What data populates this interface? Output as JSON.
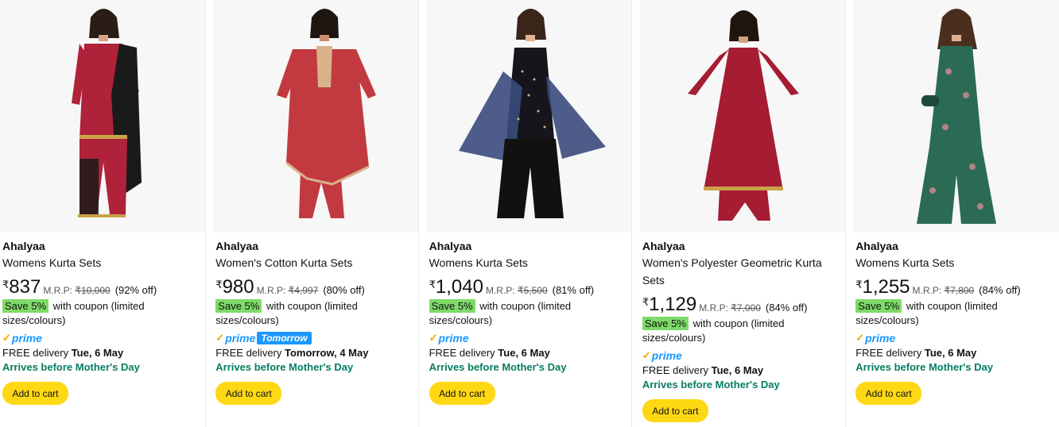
{
  "products": [
    {
      "brand": "Ahalyaa",
      "title": "Womens Kurta Sets",
      "currency": "₹",
      "price": "837",
      "mrp_label": "M.R.P:",
      "mrp": "₹10,000",
      "discount": "(92% off)",
      "coupon_badge": "Save 5%",
      "coupon_text": "with coupon (limited sizes/colours)",
      "prime": "prime",
      "prime_check": "✓",
      "delivery_prefix": "FREE delivery",
      "delivery_date": "Tue, 6 May",
      "arrives": "Arrives before Mother's Day",
      "cart": "Add to cart",
      "dress_color": "#b0213a",
      "dupatta_color": "#1a1a1a",
      "bottom_color": "#b0213a"
    },
    {
      "brand": "Ahalyaa",
      "title": "Women's Cotton Kurta Sets",
      "currency": "₹",
      "price": "980",
      "mrp_label": "M.R.P:",
      "mrp": "₹4,997",
      "discount": "(80% off)",
      "coupon_badge": "Save 5%",
      "coupon_text": "with coupon (limited sizes/colours)",
      "prime": "prime",
      "prime_check": "✓",
      "prime_tag": "Tomorrow",
      "delivery_prefix": "FREE delivery",
      "delivery_date": "Tomorrow, 4 May",
      "arrives": "Arrives before Mother's Day",
      "cart": "Add to cart",
      "dress_color": "#c23a3f",
      "bottom_color": "#c23a3f"
    },
    {
      "brand": "Ahalyaa",
      "title": "Womens Kurta Sets",
      "currency": "₹",
      "price": "1,040",
      "mrp_label": "M.R.P:",
      "mrp": "₹5,500",
      "discount": "(81% off)",
      "coupon_badge": "Save 5%",
      "coupon_text": "with coupon (limited sizes/colours)",
      "prime": "prime",
      "prime_check": "✓",
      "delivery_prefix": "FREE delivery",
      "delivery_date": "Tue, 6 May",
      "arrives": "Arrives before Mother's Day",
      "cart": "Add to cart",
      "dress_color": "#15151b",
      "dupatta_color": "#3b4a7c",
      "bottom_color": "#111111"
    },
    {
      "brand": "Ahalyaa",
      "title": "Women's Polyester Geometric Kurta Sets",
      "currency": "₹",
      "price": "1,129",
      "mrp_label": "M.R.P:",
      "mrp": "₹7,000",
      "discount": "(84% off)",
      "coupon_badge": "Save 5%",
      "coupon_text": "with coupon (limited sizes/colours)",
      "prime": "prime",
      "prime_check": "✓",
      "delivery_prefix": "FREE delivery",
      "delivery_date": "Tue, 6 May",
      "arrives": "Arrives before Mother's Day",
      "cart": "Add to cart",
      "dress_color": "#a51c33",
      "bottom_color": "#a51c33"
    },
    {
      "brand": "Ahalyaa",
      "title": "Womens Kurta Sets",
      "currency": "₹",
      "price": "1,255",
      "mrp_label": "M.R.P:",
      "mrp": "₹7,800",
      "discount": "(84% off)",
      "coupon_badge": "Save 5%",
      "coupon_text": "with coupon (limited sizes/colours)",
      "prime": "prime",
      "prime_check": "✓",
      "delivery_prefix": "FREE delivery",
      "delivery_date": "Tue, 6 May",
      "arrives": "Arrives before Mother's Day",
      "cart": "Add to cart",
      "dress_color": "#2b6b55",
      "bottom_color": "#2b6b55"
    }
  ],
  "colors": {
    "cart_button": "#ffd814",
    "save_badge": "#7fda69",
    "prime_blue": "#1a98ff",
    "prime_check": "#f7a100",
    "arrives_green": "#067d62"
  }
}
